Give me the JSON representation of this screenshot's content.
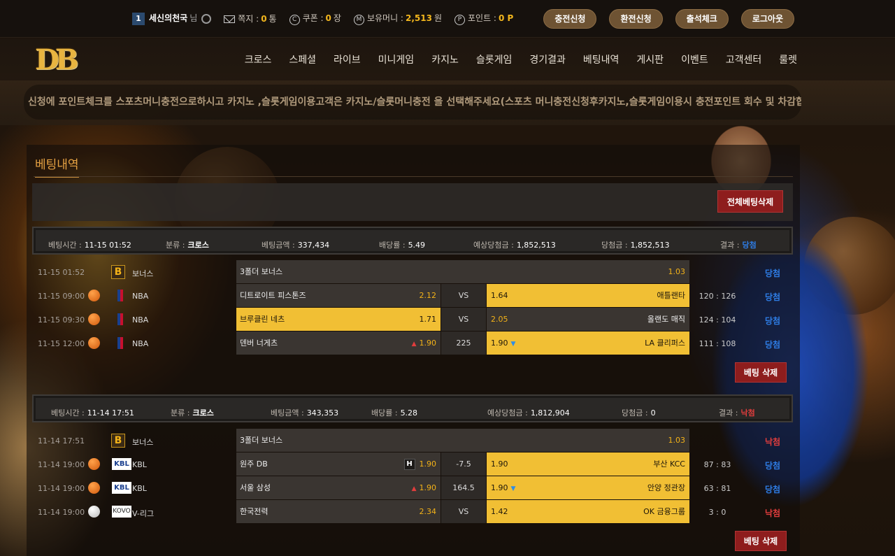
{
  "topbar": {
    "level": "1",
    "username": "세신의천국",
    "honorific": "님",
    "mail_label": "쪽지 :",
    "mail_count": "0",
    "mail_unit": "통",
    "coupon_label": "쿠폰 :",
    "coupon_count": "0",
    "coupon_unit": "장",
    "money_label": "보유머니 :",
    "money_value": "2,513",
    "money_unit": "원",
    "point_label": "포인트 :",
    "point_value": "0 P",
    "buttons": [
      "충전신청",
      "환전신청",
      "출석체크",
      "로그아웃"
    ]
  },
  "logo": "DB",
  "nav": [
    "크로스",
    "스페셜",
    "라이브",
    "미니게임",
    "카지노",
    "슬롯게임",
    "경기결과",
    "베팅내역",
    "게시판",
    "이벤트",
    "고객센터",
    "룰렛"
  ],
  "marquee": "신청에 포인트체크를 스포츠머니충전으로하시고 카지노 ,슬롯게임이용고객은 카지노/슬롯머니충전 을 선택해주세요(스포츠 머니충전신청후카지노,슬롯게임이용시 충전포인트 회수 및 차감합니",
  "panel": {
    "title": "베팅내역",
    "delete_all": "전체베팅삭제",
    "delete_bet": "베팅 삭제"
  },
  "bets": [
    {
      "summary": {
        "time_label": "베팅시간 :",
        "time": "11-15 01:52",
        "type_label": "분류 :",
        "type": "크로스",
        "amount_label": "베팅금액 :",
        "amount": "337,434",
        "odds_label": "배당률 :",
        "odds": "5.49",
        "expected_label": "예상당첨금 :",
        "expected": "1,852,513",
        "won_label": "당첨금 :",
        "won": "1,852,513",
        "result_label": "결과 :",
        "result": "당첨"
      },
      "rows": [
        {
          "time": "11-15 01:52",
          "league": "보너스",
          "bonus_name": "3폴더 보너스",
          "bonus_odd": "1.03",
          "result": "당첨"
        },
        {
          "time": "11-15 09:00",
          "league": "NBA",
          "home": "디트로이트 피스톤즈",
          "home_odd": "2.12",
          "mid": "VS",
          "away_odd": "1.64",
          "away": "애틀랜타",
          "score": "120 : 126",
          "result": "당첨"
        },
        {
          "time": "11-15 09:30",
          "league": "NBA",
          "home": "브루클린 네츠",
          "home_odd": "1.71",
          "mid": "VS",
          "away_odd": "2.05",
          "away": "올랜도 매직",
          "score": "124 : 104",
          "result": "당첨"
        },
        {
          "time": "11-15 12:00",
          "league": "NBA",
          "home": "덴버 너게츠",
          "home_odd": "1.90",
          "mid": "225",
          "away_odd": "1.90",
          "away": "LA 클리퍼스",
          "score": "111 : 108",
          "result": "당첨"
        }
      ]
    },
    {
      "summary": {
        "time_label": "베팅시간 :",
        "time": "11-14 17:51",
        "type_label": "분류 :",
        "type": "크로스",
        "amount_label": "베팅금액 :",
        "amount": "343,353",
        "odds_label": "배당률 :",
        "odds": "5.28",
        "expected_label": "예상당첨금 :",
        "expected": "1,812,904",
        "won_label": "당첨금 :",
        "won": "0",
        "result_label": "결과 :",
        "result": "낙첨"
      },
      "rows": [
        {
          "time": "11-14 17:51",
          "league": "보너스",
          "bonus_name": "3폴더 보너스",
          "bonus_odd": "1.03",
          "result": "낙첨"
        },
        {
          "time": "11-14 19:00",
          "league": "KBL",
          "home": "원주 DB",
          "home_badge": "H",
          "home_odd": "1.90",
          "mid": "-7.5",
          "away_odd": "1.90",
          "away": "부산 KCC",
          "score": "87 : 83",
          "result": "당첨"
        },
        {
          "time": "11-14 19:00",
          "league": "KBL",
          "home": "서울 삼성",
          "home_odd": "1.90",
          "mid": "164.5",
          "away_odd": "1.90",
          "away": "안양 정관장",
          "score": "63 : 81",
          "result": "당첨"
        },
        {
          "time": "11-14 19:00",
          "league": "V-리그",
          "home": "한국전력",
          "home_odd": "2.34",
          "mid": "VS",
          "away_odd": "1.42",
          "away": "OK 금융그룹",
          "score": "3 : 0",
          "result": "낙첨"
        }
      ]
    }
  ],
  "icons": {
    "bonus": "B",
    "kbl": "KBL",
    "vleague": "KOVO"
  },
  "colors": {
    "accent": "#f1bf34",
    "win": "#2e7de6",
    "lose": "#e23d3d",
    "button": "#8e1d1d"
  }
}
